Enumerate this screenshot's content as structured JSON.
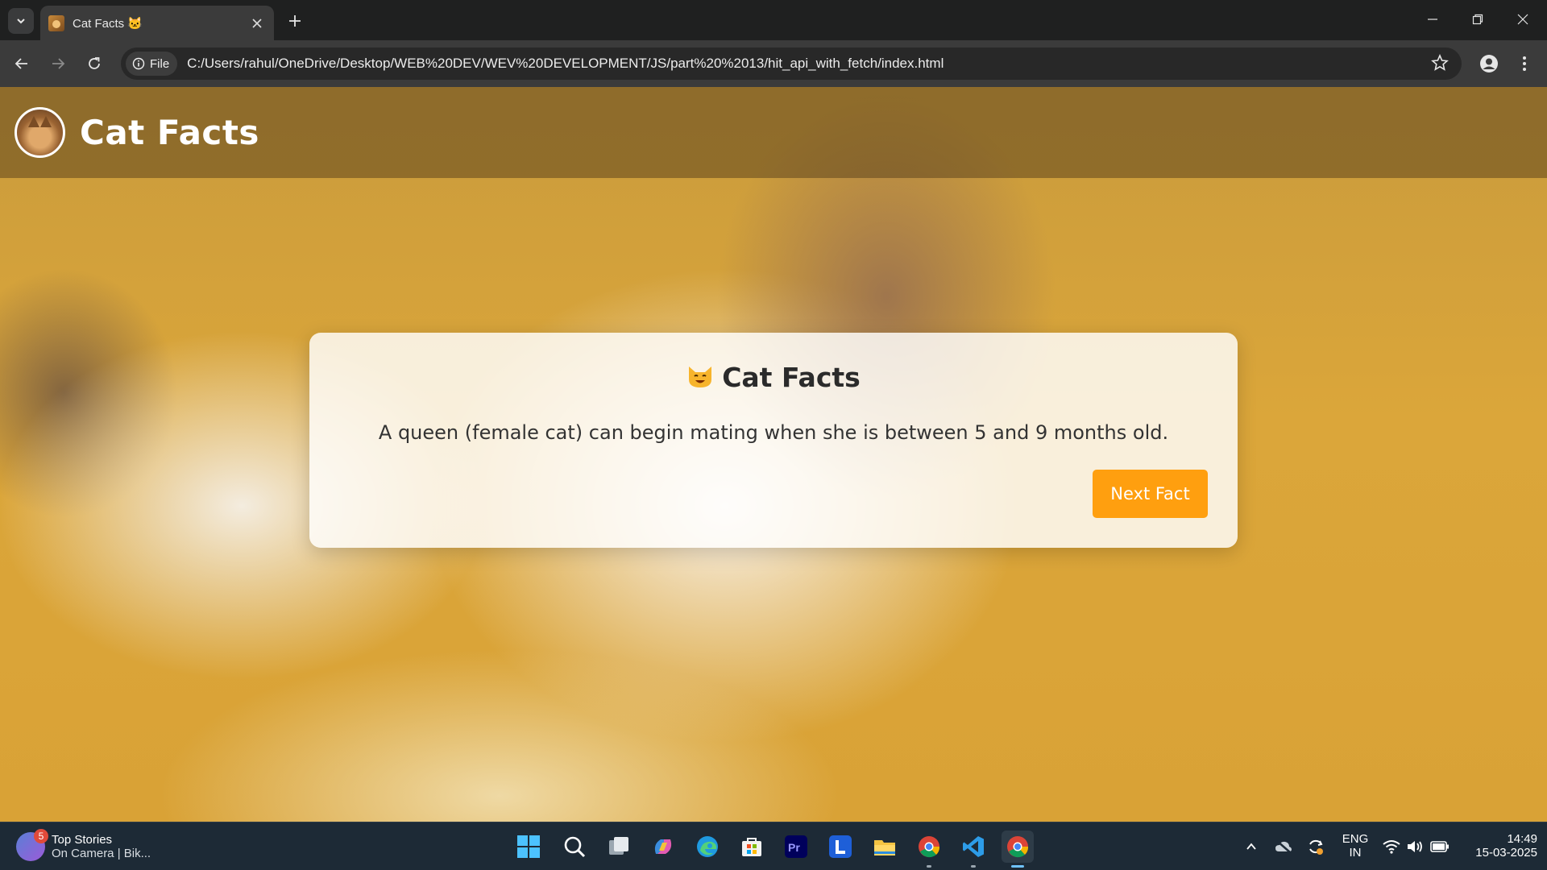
{
  "browser": {
    "tab_title": "Cat Facts 🐱",
    "url": "C:/Users/rahul/OneDrive/Desktop/WEB%20DEV/WEV%20DEVELOPMENT/JS/part%20%2013/hit_api_with_fetch/index.html",
    "file_chip_label": "File"
  },
  "page": {
    "site_title": "Cat Facts",
    "card_heading": "Cat Facts",
    "fact": "A queen (female cat) can begin mating when she is between 5 and 9 months old.",
    "next_button_label": "Next Fact",
    "accent_color": "#ff9f0f"
  },
  "taskbar": {
    "widget_badge": "5",
    "widget_title": "Top Stories",
    "widget_subtitle": "On Camera | Bik...",
    "language_line1": "ENG",
    "language_line2": "IN",
    "time": "14:49",
    "date": "15-03-2025"
  }
}
